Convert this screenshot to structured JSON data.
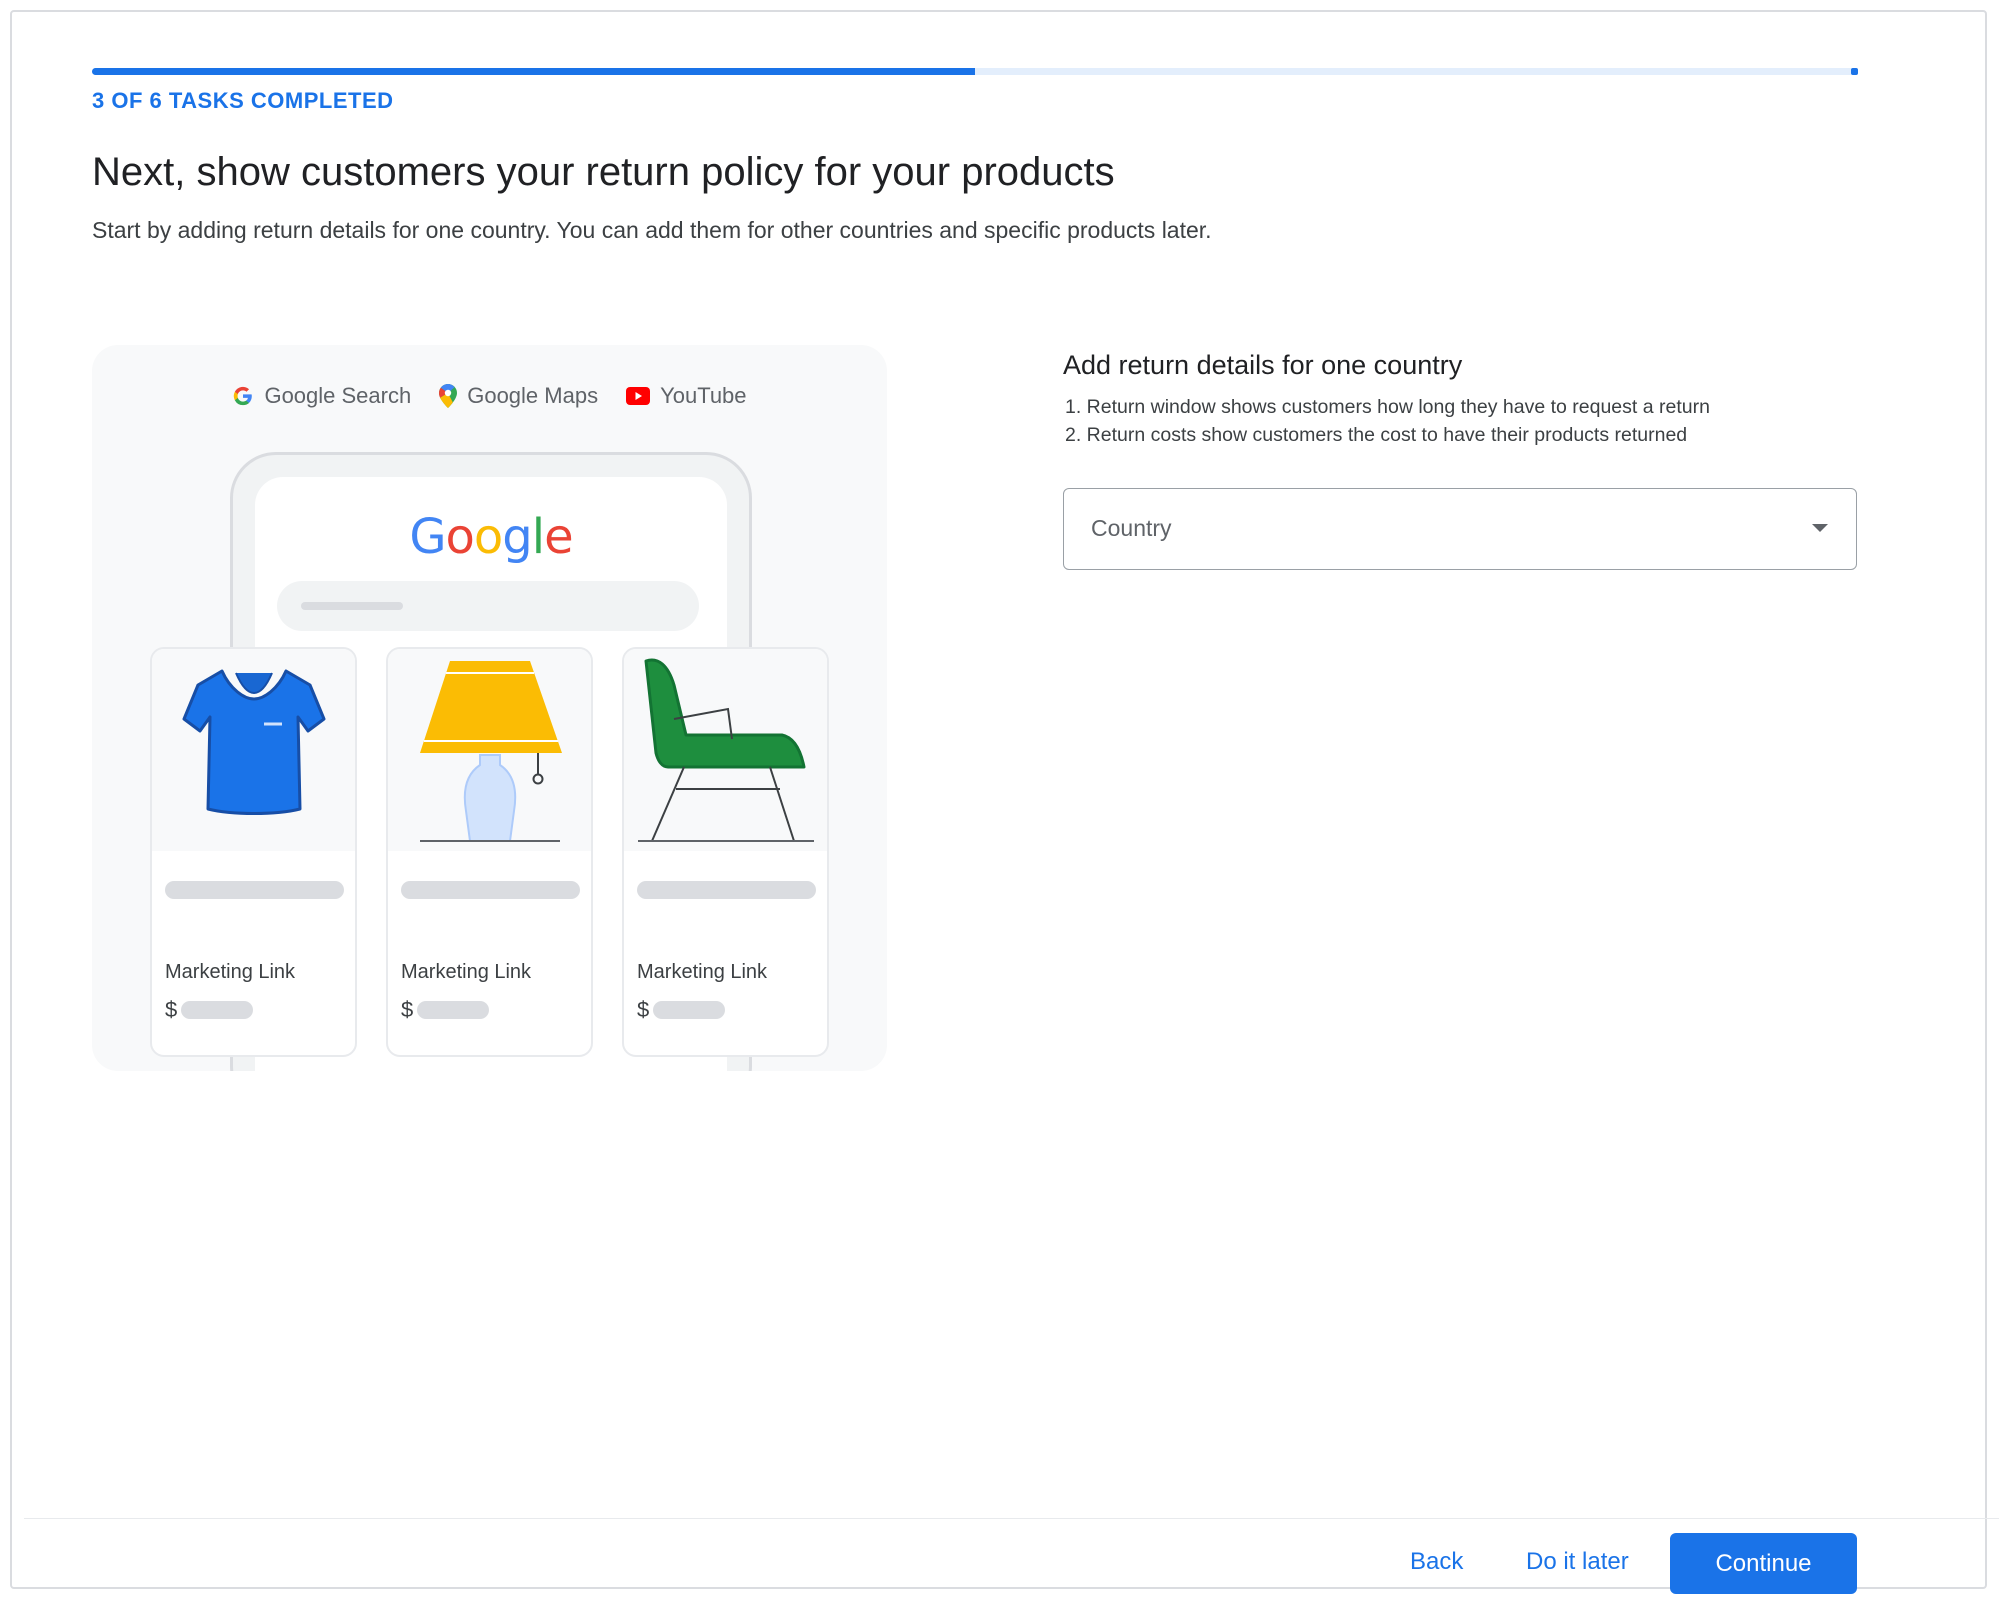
{
  "progress": {
    "label": "3 OF 6 TASKS COMPLETED",
    "completed": 3,
    "total": 6
  },
  "header": {
    "title": "Next, show customers your return policy for your products",
    "subtitle": "Start by adding return details for one country. You can add them for other countries and specific products later."
  },
  "illustration": {
    "brands": [
      "Google Search",
      "Google Maps",
      "YouTube"
    ],
    "logo_letters": [
      {
        "ch": "G",
        "color": "#4285F4"
      },
      {
        "ch": "o",
        "color": "#EA4335"
      },
      {
        "ch": "o",
        "color": "#FBBC05"
      },
      {
        "ch": "g",
        "color": "#4285F4"
      },
      {
        "ch": "l",
        "color": "#34A853"
      },
      {
        "ch": "e",
        "color": "#EA4335"
      }
    ],
    "cards": [
      {
        "link": "Marketing Link",
        "currency": "$",
        "icon": "tshirt-icon"
      },
      {
        "link": "Marketing Link",
        "currency": "$",
        "icon": "lamp-icon"
      },
      {
        "link": "Marketing Link",
        "currency": "$",
        "icon": "chair-icon"
      }
    ]
  },
  "details": {
    "title": "Add return details for one country",
    "steps": [
      "1. Return window shows customers how long they have to request a return",
      "2. Return costs show customers the cost to have their products returned"
    ],
    "country_select": {
      "label": "Country",
      "icon": "arrow-drop-down-icon"
    }
  },
  "footer": {
    "back_label": "Back",
    "later_label": "Do it later",
    "continue_label": "Continue"
  },
  "colors": {
    "accent": "#1a73e8",
    "tshirt": "#1a73e8",
    "lamp_shade": "#fbbc04",
    "lamp_base": "#d2e3fc",
    "chair": "#1e8e3e"
  }
}
